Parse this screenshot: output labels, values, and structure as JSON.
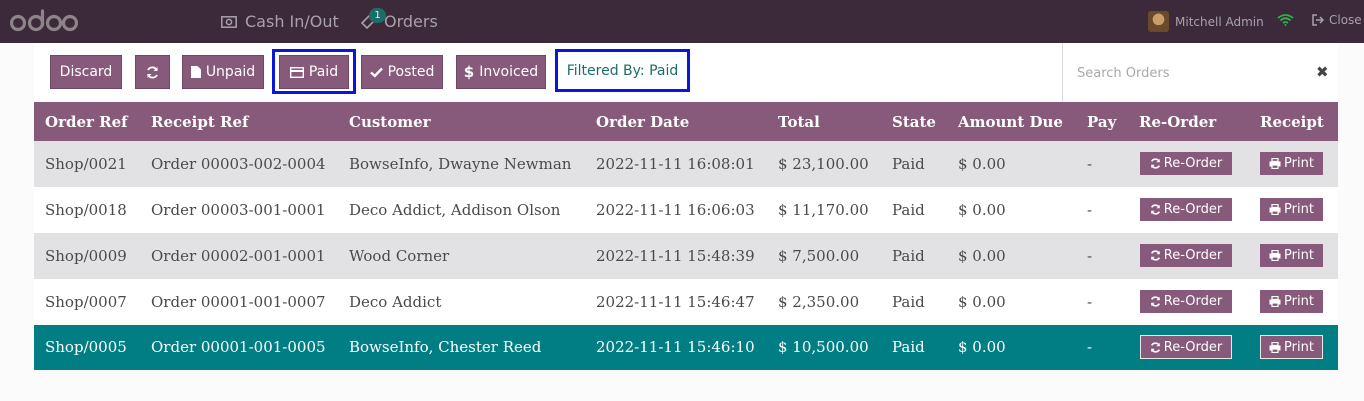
{
  "nav": {
    "logo_text": "odoo",
    "cash_label": "Cash In/Out",
    "orders_label": "Orders",
    "orders_badge": "1",
    "user_name": "Mitchell Admin",
    "close_label": "Close",
    "icons": {
      "cash": "money-icon",
      "orders": "orders-icon",
      "wifi": "wifi-icon",
      "close": "sign-out-icon"
    },
    "wifi_color": "#2bb24c"
  },
  "controls": {
    "discard_label": "Discard",
    "refresh_icon": "refresh-icon",
    "unpaid_label": "Unpaid",
    "paid_label": "Paid",
    "posted_label": "Posted",
    "invoiced_label": "Invoiced",
    "filter_label": "Filtered By: Paid",
    "search_placeholder": "Search Orders",
    "accent_color": "#875a7b",
    "highlight_color": "#0c16d8"
  },
  "table": {
    "headers": [
      "Order Ref",
      "Receipt Ref",
      "Customer",
      "Order Date",
      "Total",
      "State",
      "Amount Due",
      "Pay",
      "Re-Order",
      "Receipt"
    ],
    "reorder_label": "Re-Order",
    "print_label": "Print",
    "rows": [
      {
        "order_ref": "Shop/0021",
        "receipt_ref": "Order 00003-002-0004",
        "customer": "BowseInfo, Dwayne Newman",
        "date": "2022-11-11 16:08:01",
        "total": "$ 23,100.00",
        "state": "Paid",
        "due": "$ 0.00",
        "pay": "-"
      },
      {
        "order_ref": "Shop/0018",
        "receipt_ref": "Order 00003-001-0001",
        "customer": "Deco Addict, Addison Olson",
        "date": "2022-11-11 16:06:03",
        "total": "$ 11,170.00",
        "state": "Paid",
        "due": "$ 0.00",
        "pay": "-"
      },
      {
        "order_ref": "Shop/0009",
        "receipt_ref": "Order 00002-001-0001",
        "customer": "Wood Corner",
        "date": "2022-11-11 15:48:39",
        "total": "$ 7,500.00",
        "state": "Paid",
        "due": "$ 0.00",
        "pay": "-"
      },
      {
        "order_ref": "Shop/0007",
        "receipt_ref": "Order 00001-001-0007",
        "customer": "Deco Addict",
        "date": "2022-11-11 15:46:47",
        "total": "$ 2,350.00",
        "state": "Paid",
        "due": "$ 0.00",
        "pay": "-"
      },
      {
        "order_ref": "Shop/0005",
        "receipt_ref": "Order 00001-001-0005",
        "customer": "BowseInfo, Chester Reed",
        "date": "2022-11-11 15:46:10",
        "total": "$ 10,500.00",
        "state": "Paid",
        "due": "$ 0.00",
        "pay": "-"
      }
    ],
    "selected_row_color": "#017e84"
  }
}
